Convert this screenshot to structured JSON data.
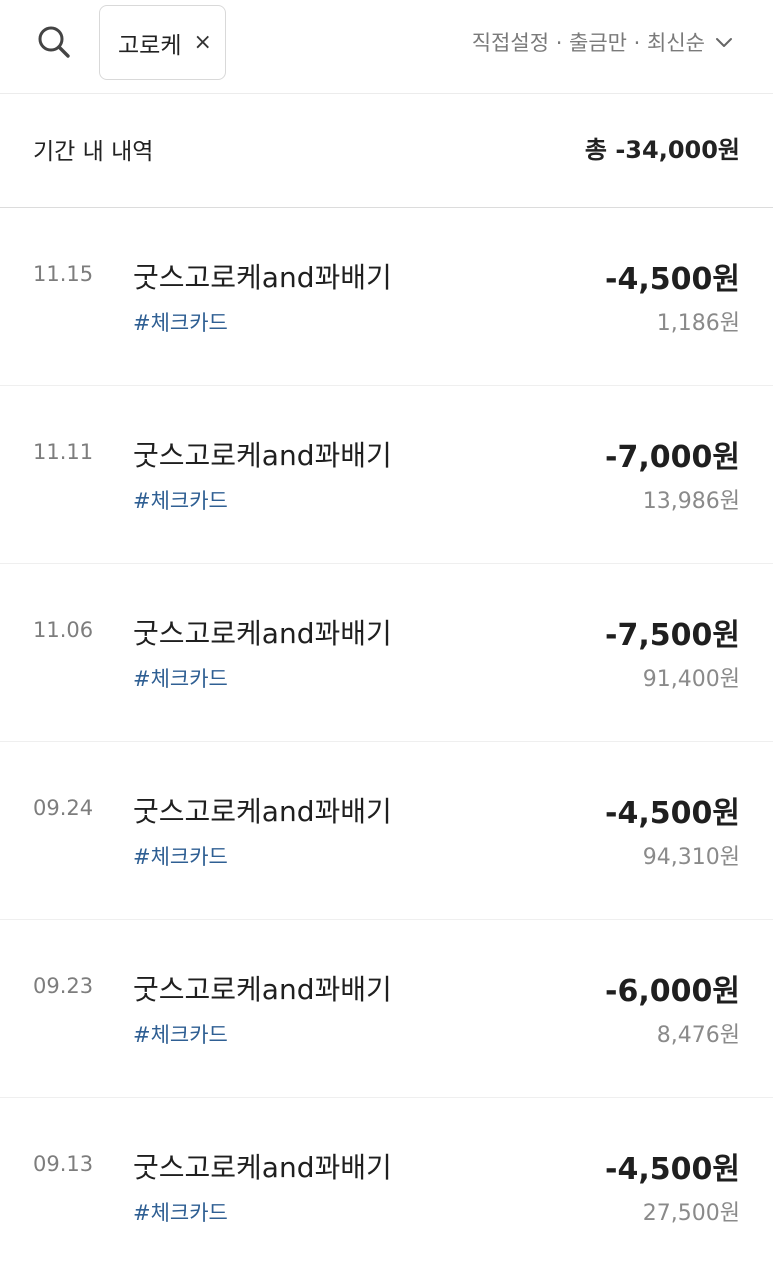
{
  "search": {
    "icon": "search-icon",
    "keyword": "고로케",
    "clear_glyph": "×"
  },
  "filter": {
    "label": "직접설정 · 출금만 · 최신순",
    "icon": "chevron-down-icon"
  },
  "summary": {
    "label": "기간 내 내역",
    "total": "총 -34,000원"
  },
  "transactions": [
    {
      "date": "11.15",
      "merchant": "굿스고로케and꽈배기",
      "tag": "#체크카드",
      "amount": "-4,500원",
      "balance": "1,186원"
    },
    {
      "date": "11.11",
      "merchant": "굿스고로케and꽈배기",
      "tag": "#체크카드",
      "amount": "-7,000원",
      "balance": "13,986원"
    },
    {
      "date": "11.06",
      "merchant": "굿스고로케and꽈배기",
      "tag": "#체크카드",
      "amount": "-7,500원",
      "balance": "91,400원"
    },
    {
      "date": "09.24",
      "merchant": "굿스고로케and꽈배기",
      "tag": "#체크카드",
      "amount": "-4,500원",
      "balance": "94,310원"
    },
    {
      "date": "09.23",
      "merchant": "굿스고로케and꽈배기",
      "tag": "#체크카드",
      "amount": "-6,000원",
      "balance": "8,476원"
    },
    {
      "date": "09.13",
      "merchant": "굿스고로케and꽈배기",
      "tag": "#체크카드",
      "amount": "-4,500원",
      "balance": "27,500원"
    }
  ],
  "colors": {
    "tag": "#2f5f93",
    "secondary_text": "#8a8a8a",
    "primary_text": "#1f1f1f"
  }
}
